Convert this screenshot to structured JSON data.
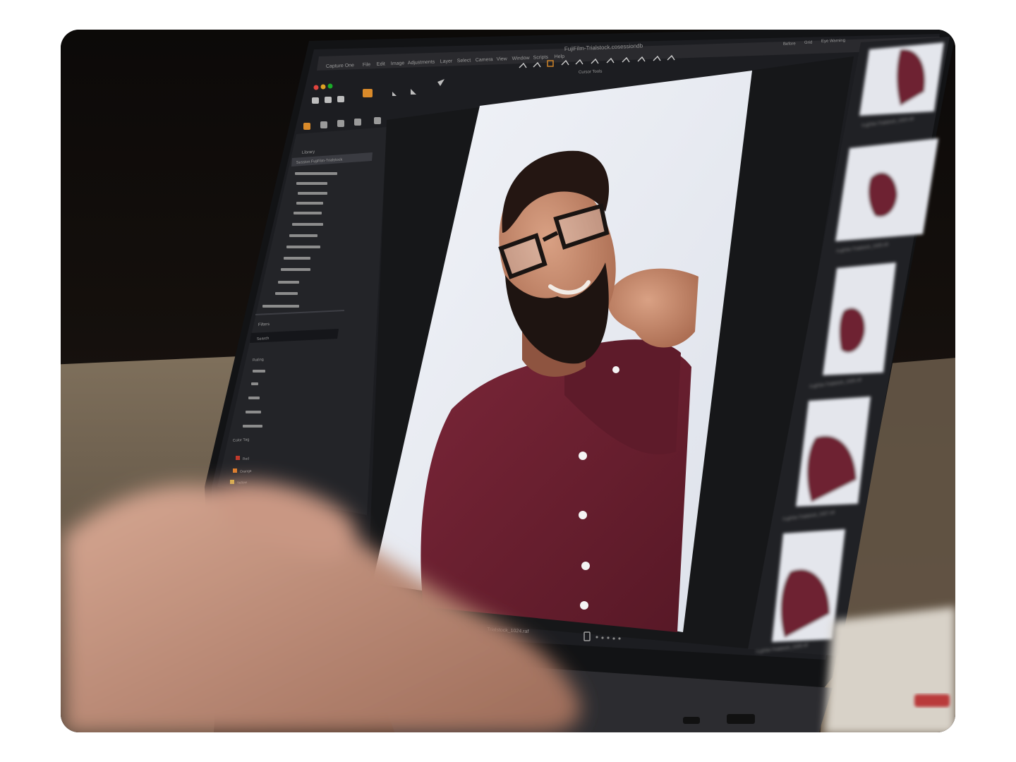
{
  "photo": {
    "description_hidden": "",
    "app": {
      "menu_app": "Capture One",
      "menu_items": [
        "File",
        "Edit",
        "Image",
        "Adjustments",
        "Layer",
        "Select",
        "Camera",
        "View",
        "Window",
        "Scripts",
        "Help"
      ],
      "document_title": "FujiFilm-Trialstock.cosessiondb",
      "cursor_tools_label": "Cursor Tools",
      "right_header": [
        "Before",
        "Grid",
        "Eye Warning"
      ],
      "left_panel_title": "Library",
      "session_name": "Session FujiFilm-Trialstock",
      "filters_title": "Filters",
      "search_placeholder": "Search",
      "rating_title": "Rating",
      "color_tag_title": "Color Tag",
      "color_tags": [
        "Red",
        "Orange",
        "Yellow"
      ],
      "filmstrip_captions": [
        "FujiFilm-Trialstock_1024.raf",
        "FujiFilm-Trialstock_1025.raf",
        "FujiFilm-Trialstock_1026.raf",
        "FujiFilm-Trialstock_1027.raf",
        "FujiFilm-Trialstock_1028.raf"
      ],
      "viewer_filename": "Trialstock_1024.raf"
    },
    "colors": {
      "shirt": "#6e2233",
      "backdrop": "#e6e9f1",
      "ui_dark": "#1c1d21",
      "accent_orange": "#d98a2a",
      "tag_red": "#c0392b",
      "tag_orange": "#e07b24",
      "tag_yellow": "#e6c12a"
    }
  }
}
